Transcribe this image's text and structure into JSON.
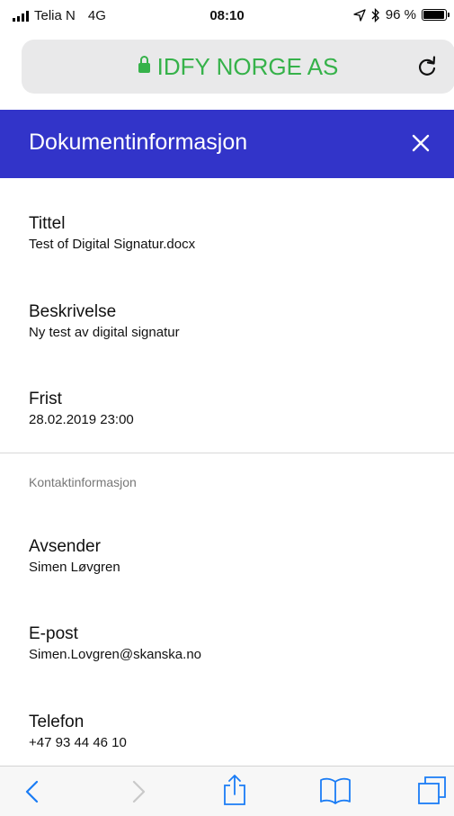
{
  "status_bar": {
    "carrier": "Telia N",
    "network": "4G",
    "time": "08:10",
    "battery": "96 %",
    "battery_level": 0.96
  },
  "address_bar": {
    "title": "IDFY NORGE AS",
    "secure_color": "#36b24a"
  },
  "header": {
    "title": "Dokumentinformasjon",
    "background": "#3234c9"
  },
  "document": {
    "title_label": "Tittel",
    "title_value": "Test of Digital Signatur.docx",
    "description_label": "Beskrivelse",
    "description_value": "Ny test av digital signatur",
    "deadline_label": "Frist",
    "deadline_value": "28.02.2019 23:00"
  },
  "contact": {
    "section_title": "Kontaktinformasjon",
    "sender_label": "Avsender",
    "sender_value": "Simen Løvgren",
    "email_label": "E-post",
    "email_value": "Simen.Lovgren@skanska.no",
    "phone_label": "Telefon",
    "phone_value": "+47 93 44 46 10"
  },
  "toolbar": {
    "icons": [
      "back-icon",
      "forward-icon",
      "share-icon",
      "bookmarks-icon",
      "tabs-icon"
    ],
    "accent": "#1a7cf5"
  }
}
